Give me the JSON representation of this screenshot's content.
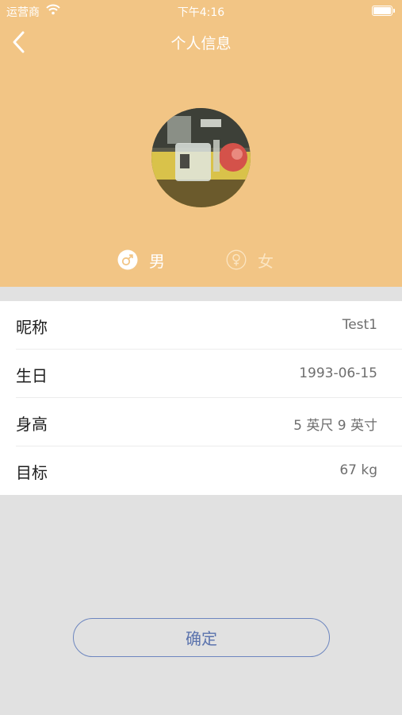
{
  "status_bar": {
    "carrier": "运营商",
    "time": "下午4:16"
  },
  "nav": {
    "title": "个人信息"
  },
  "gender": {
    "male_label": "男",
    "female_label": "女",
    "selected": "male"
  },
  "profile_rows": [
    {
      "label": "昵称",
      "value": "Test1"
    },
    {
      "label": "生日",
      "value": "1993-06-15"
    },
    {
      "label": "身高",
      "value": "5 英尺 9 英寸"
    },
    {
      "label": "目标",
      "value": "67 kg"
    }
  ],
  "confirm": {
    "label": "确定"
  },
  "colors": {
    "header_bg": "#f2c585",
    "page_bg": "#e1e1e1",
    "button_border": "#6d86bf",
    "button_text": "#5b73ad"
  }
}
